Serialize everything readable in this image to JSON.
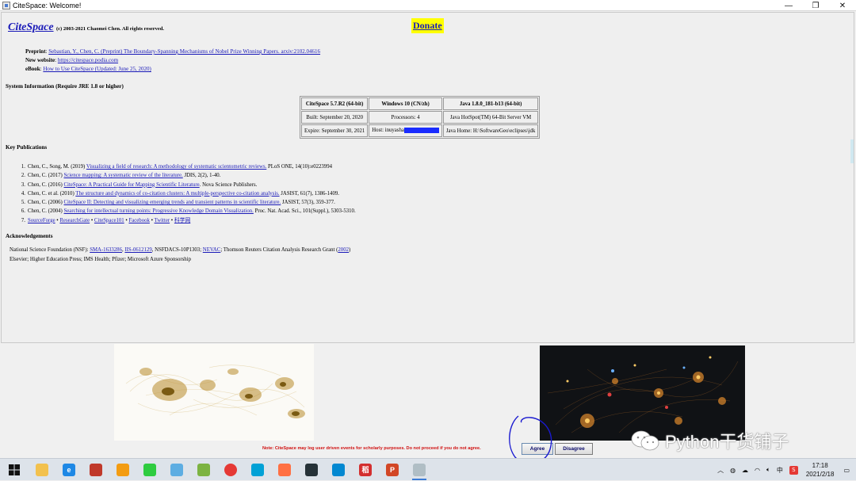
{
  "window": {
    "title": "CiteSpace: Welcome!",
    "controls": [
      "—",
      "❐",
      "✕"
    ]
  },
  "header": {
    "logo": "CiteSpace",
    "copyright": "(c) 2003-2021 Chaomei Chen. All rights reserved.",
    "donate": "Donate"
  },
  "info": {
    "preprint_label": "Preprint",
    "preprint_link": "Sebastian, Y., Chen, C. (Preprint) The Boundary-Spanning Mechanisms of Nobel Prize Winning Papers. arxiv:2102.04616",
    "website_label": "New website",
    "website_link": "https://citespace.podia.com",
    "ebook_label": "eBook",
    "ebook_link": "How to Use CiteSpace (Updated: June 25, 2020)"
  },
  "system": {
    "title": "System Information (Require JRE 1.8 or higher)",
    "rows": [
      [
        "CiteSpace 5.7.R2 (64-bit)",
        "Windows 10 (CN/zh)",
        "Java 1.8.0_181-b13 (64-bit)"
      ],
      [
        "Built: September 20, 2020",
        "Processors: 4",
        "Java HotSpot(TM) 64-Bit Server VM"
      ],
      [
        "Expire: September 30, 2021",
        "Host: inuyasha",
        "Java Home: H:\\SoftwareGeo\\eclipses\\jdk"
      ]
    ]
  },
  "publications": {
    "title": "Key Publications",
    "items": [
      {
        "num": "1.",
        "pre": "Chen, C., Song, M. (2019) ",
        "link": "Visualizing a field of research: A methodology of systematic scientometric reviews.",
        "post": " PLoS ONE, 14(10):e0223994"
      },
      {
        "num": "2.",
        "pre": "Chen, C. (2017) ",
        "link": "Science mapping: A systematic review of the literature.",
        "post": " JDIS, 2(2), 1-40."
      },
      {
        "num": "3.",
        "pre": "Chen, C. (2016) ",
        "link": "CiteSpace: A Practical Guide for Mapping Scientific Literature",
        "post": ". Nova Science Publishers."
      },
      {
        "num": "4.",
        "pre": "Chen, C. et al. (2010) ",
        "link": "The structure and dynamics of co-citation clusters: A multiple-perspective co-citation analysis.",
        "post": " JASIST, 61(7), 1386-1409."
      },
      {
        "num": "5.",
        "pre": "Chen, C. (2006) ",
        "link": "CiteSpace II: Detecting and visualizing emerging trends and transient patterns in scientific literature.",
        "post": " JASIST, 57(3), 359-377."
      },
      {
        "num": "6.",
        "pre": "Chen, C. (2004) ",
        "link": "Searching for intellectual turning points: Progressive Knowledge Domain Visualization.",
        "post": " Proc. Nat. Acad. Sci., 101(Suppl.), 5303-5310."
      }
    ],
    "social": [
      "SourceForge",
      "ResearchGate",
      "CiteSpace101",
      "Facebook",
      "Twitter",
      "科学网"
    ],
    "social_num": "7.",
    "separator": " • "
  },
  "acknowledgements": {
    "title": "Acknowledgements",
    "line1_pre": "National Science Foundation (NSF): ",
    "line1_links": [
      "SMA-1633286",
      "IIS-0612129"
    ],
    "line1_mid": ", NSFDACS-10P1303; ",
    "line1_link3": "NEVAC",
    "line1_post": "; Thomson Reuters Citation Analysis Research Grant (",
    "line1_link4": "2002",
    "line1_end": ")",
    "line2": "Elsevier; Higher Education Press; IMS Health; Pfizer; Microsoft Azure Sponsorship"
  },
  "footer": {
    "notice": "Note: CiteSpace may log user driven events for scholarly purposes. Do not proceed if you do not agree.",
    "agree": "Agree",
    "disagree": "Disagree"
  },
  "watermark": "Python干货铺子",
  "taskbar": {
    "apps": [
      {
        "name": "file-explorer",
        "color": "#f2c14e",
        "glyph": ""
      },
      {
        "name": "edge-browser",
        "color": "#1e88e5",
        "glyph": "e"
      },
      {
        "name": "app-3",
        "color": "#c0392b",
        "glyph": ""
      },
      {
        "name": "search-app",
        "color": "#f39c12",
        "glyph": ""
      },
      {
        "name": "wechat",
        "color": "#2ecc40",
        "glyph": ""
      },
      {
        "name": "app-6",
        "color": "#5dade2",
        "glyph": ""
      },
      {
        "name": "app-7",
        "color": "#7cb342",
        "glyph": ""
      },
      {
        "name": "chrome-browser",
        "color": "#e53935",
        "glyph": ""
      },
      {
        "name": "bilibili",
        "color": "#00a1d6",
        "glyph": ""
      },
      {
        "name": "app-10",
        "color": "#ff7043",
        "glyph": ""
      },
      {
        "name": "photos",
        "color": "#263238",
        "glyph": ""
      },
      {
        "name": "app-12",
        "color": "#0288d1",
        "glyph": ""
      },
      {
        "name": "app-13",
        "color": "#d32f2f",
        "glyph": "稻"
      },
      {
        "name": "powerpoint",
        "color": "#d24726",
        "glyph": "P"
      },
      {
        "name": "java-app",
        "color": "#b0bec5",
        "glyph": ""
      }
    ],
    "tray_lang": "中",
    "time": "17:18",
    "date": "2021/2/18"
  }
}
